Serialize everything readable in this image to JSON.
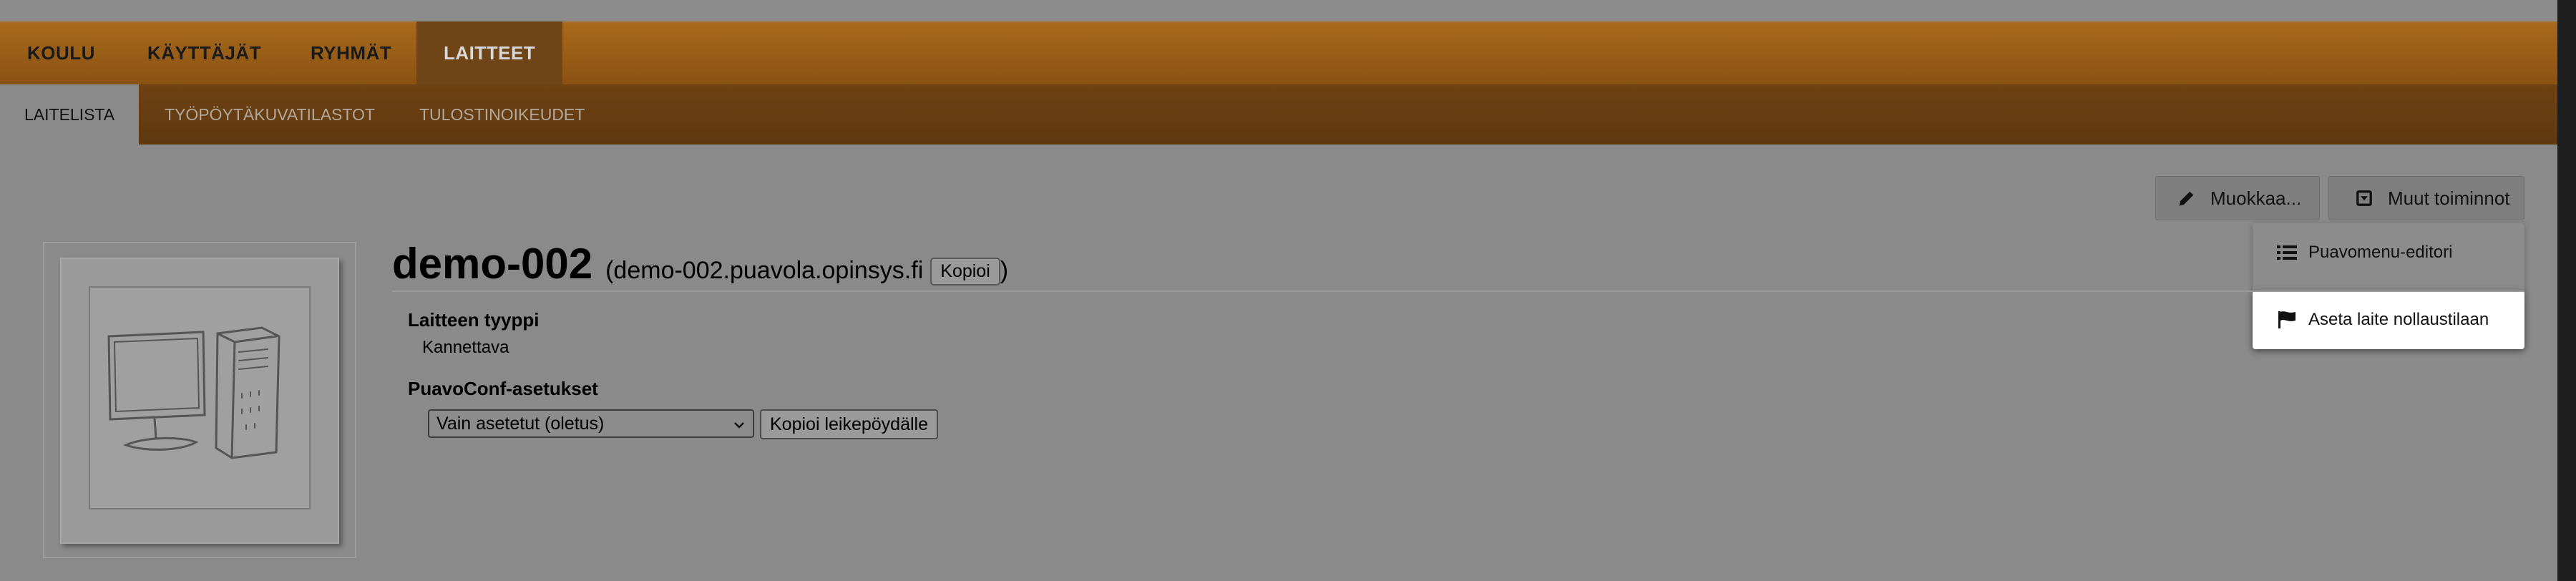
{
  "main_nav": {
    "tabs": [
      {
        "label": "KOULU"
      },
      {
        "label": "KÄYTTÄJÄT"
      },
      {
        "label": "RYHMÄT"
      },
      {
        "label": "LAITTEET"
      }
    ]
  },
  "sub_nav": {
    "tabs": [
      {
        "label": "LAITELISTA"
      },
      {
        "label": "TYÖPÖYTÄKUVATILASTOT"
      },
      {
        "label": "TULOSTINOIKEUDET"
      }
    ]
  },
  "actions": {
    "edit_label": "Muokkaa...",
    "other_label": "Muut toiminnot",
    "menu": [
      {
        "label": "Puavomenu-editori",
        "icon": "list-icon"
      },
      {
        "label": "Aseta laite nollaustilaan",
        "icon": "flag-icon"
      }
    ]
  },
  "device": {
    "name": "demo-002",
    "fqdn_open": "(demo-002.puavola.opinsys.fi",
    "copy_label": "Kopioi",
    "fqdn_close": ")",
    "type_label": "Laitteen tyyppi",
    "type_value": "Kannettava",
    "puavoconf_label": "PuavoConf-asetukset",
    "puavoconf_select": "Vain asetetut (oletus)",
    "copy_clipboard_label": "Kopioi leikepöydälle"
  }
}
